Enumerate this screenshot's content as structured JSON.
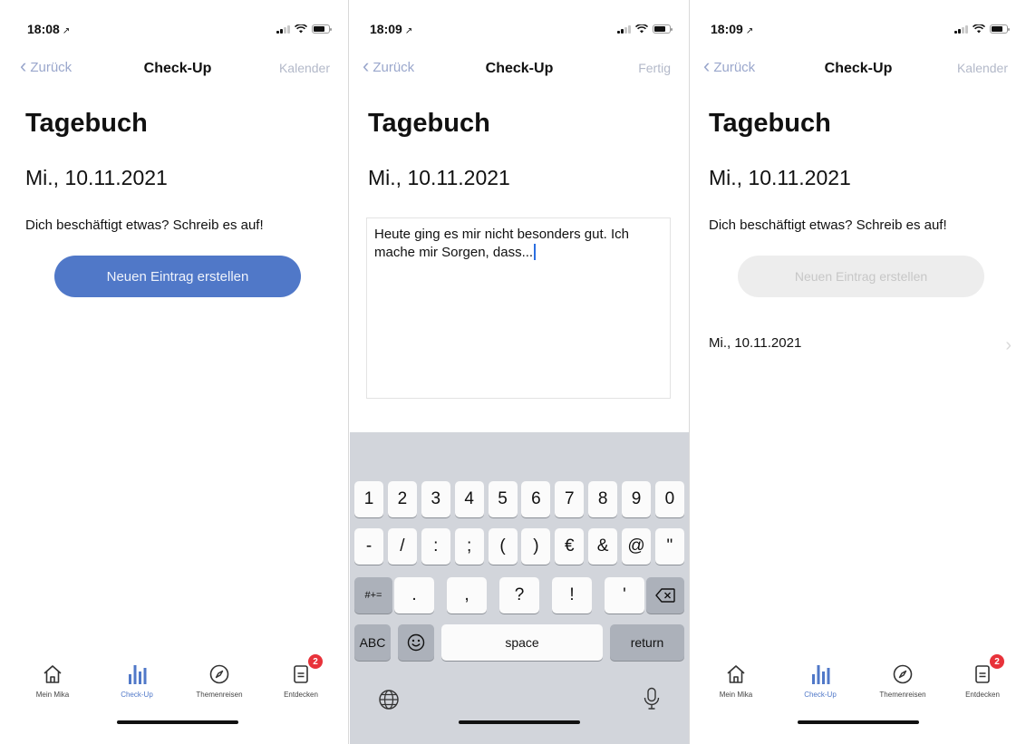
{
  "screens": [
    {
      "time": "18:08",
      "nav": {
        "back": "Zurück",
        "title": "Check-Up",
        "right": "Kalender"
      },
      "heading": "Tagebuch",
      "date": "Mi., 10.11.2021",
      "prompt": "Dich beschäftigt etwas? Schreib es auf!",
      "button": "Neuen Eintrag erstellen"
    },
    {
      "time": "18:09",
      "nav": {
        "back": "Zurück",
        "title": "Check-Up",
        "right": "Fertig"
      },
      "heading": "Tagebuch",
      "date": "Mi., 10.11.2021",
      "entry_text": "Heute ging es mir nicht besonders gut. Ich mache mir Sorgen, dass..."
    },
    {
      "time": "18:09",
      "nav": {
        "back": "Zurück",
        "title": "Check-Up",
        "right": "Kalender"
      },
      "heading": "Tagebuch",
      "date": "Mi., 10.11.2021",
      "prompt": "Dich beschäftigt etwas? Schreib es auf!",
      "button": "Neuen Eintrag erstellen",
      "entry_label": "Mi., 10.11.2021"
    }
  ],
  "tabs": [
    {
      "label": "Mein Mika",
      "icon": "home-icon"
    },
    {
      "label": "Check-Up",
      "icon": "chart-bars-icon"
    },
    {
      "label": "Themenreisen",
      "icon": "compass-icon"
    },
    {
      "label": "Entdecken",
      "icon": "document-icon",
      "badge": "2"
    }
  ],
  "keyboard": {
    "row1": [
      "1",
      "2",
      "3",
      "4",
      "5",
      "6",
      "7",
      "8",
      "9",
      "0"
    ],
    "row2": [
      "-",
      "/",
      ":",
      ";",
      "(",
      ")",
      "€",
      "&",
      "@",
      "\""
    ],
    "row3": [
      ".",
      ",",
      "?",
      "!",
      "'"
    ],
    "shift_label": "#+=",
    "abc": "ABC",
    "space": "space",
    "return": "return"
  },
  "colors": {
    "accent": "#5078c8",
    "badge": "#e8323a",
    "keyboard_bg": "#d2d5db"
  }
}
